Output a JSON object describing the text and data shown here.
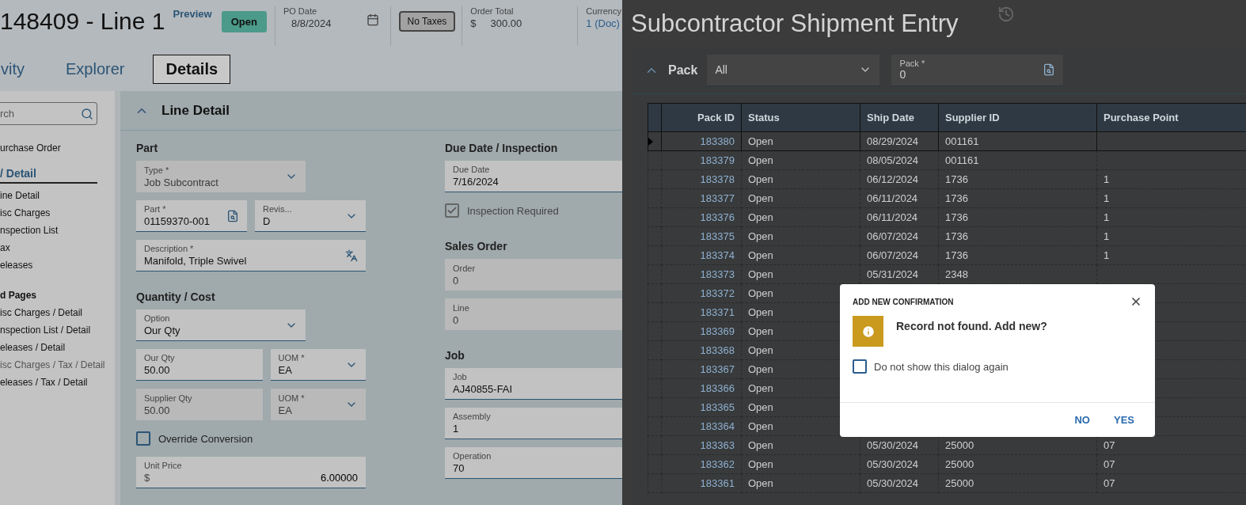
{
  "left_window": {
    "title": "148409 - Line 1",
    "preview_label": "Preview",
    "status_badge": "Open",
    "po_date": {
      "label": "PO Date",
      "value": "8/8/2024"
    },
    "tax_button": "No Taxes",
    "order_total": {
      "label": "Order Total",
      "currency_symbol": "$",
      "value": "300.00"
    },
    "currency": {
      "label": "Currency",
      "value": "1 (Doc)"
    },
    "tabs": [
      {
        "label": "vity",
        "selected": false
      },
      {
        "label": "Explorer",
        "selected": false
      },
      {
        "label": "Details",
        "selected": true
      }
    ],
    "sidebar": {
      "search": {
        "placeholder": "rch"
      },
      "items": [
        {
          "label": "urchase Order",
          "kind": "link",
          "disabled": false
        },
        {
          "label": "/ Detail",
          "kind": "current",
          "disabled": false
        },
        {
          "label": "ine Detail",
          "kind": "link",
          "disabled": false
        },
        {
          "label": "isc Charges",
          "kind": "link",
          "disabled": false
        },
        {
          "label": "nspection List",
          "kind": "link",
          "disabled": false
        },
        {
          "label": "ax",
          "kind": "link",
          "disabled": false
        },
        {
          "label": "eleases",
          "kind": "link",
          "disabled": false
        },
        {
          "label": "d Pages",
          "kind": "heading",
          "disabled": false
        },
        {
          "label": "isc Charges / Detail",
          "kind": "link",
          "disabled": false
        },
        {
          "label": "nspection List / Detail",
          "kind": "link",
          "disabled": false
        },
        {
          "label": "eleases / Detail",
          "kind": "link",
          "disabled": false
        },
        {
          "label": "isc Charges / Tax / Detail",
          "kind": "link",
          "disabled": true
        },
        {
          "label": "eleases / Tax / Detail",
          "kind": "link",
          "disabled": false
        }
      ]
    },
    "panel": {
      "title": "Line Detail",
      "expanded": true,
      "columns": [
        [
          {
            "title": "Part",
            "rows": [
              {
                "kind": "fields",
                "fields": [
                  {
                    "label": "Type *",
                    "value": "Job Subcontract",
                    "kind": "select",
                    "disabled": true
                  }
                ]
              },
              {
                "kind": "fields",
                "fields": [
                  {
                    "label": "Part *",
                    "value": "01159370-001",
                    "kind": "lookup",
                    "disabled": false
                  },
                  {
                    "label": "Revis...",
                    "value": "D",
                    "kind": "select",
                    "disabled": false
                  }
                ]
              },
              {
                "kind": "fields",
                "fields": [
                  {
                    "label": "Description *",
                    "value": "Manifold, Triple Swivel",
                    "kind": "translate",
                    "disabled": false
                  }
                ]
              }
            ]
          },
          {
            "title": "Quantity / Cost",
            "rows": [
              {
                "kind": "fields",
                "fields": [
                  {
                    "label": "Option",
                    "value": "Our Qty",
                    "kind": "select",
                    "disabled": false
                  }
                ]
              },
              {
                "kind": "fields",
                "fields": [
                  {
                    "label": "Our Qty",
                    "value": "50.00",
                    "kind": "text",
                    "disabled": false
                  },
                  {
                    "label": "UOM *",
                    "value": "EA",
                    "kind": "select",
                    "disabled": false
                  }
                ]
              },
              {
                "kind": "fields",
                "fields": [
                  {
                    "label": "Supplier Qty",
                    "value": "50.00",
                    "kind": "text",
                    "disabled": true
                  },
                  {
                    "label": "UOM *",
                    "value": "EA",
                    "kind": "select",
                    "disabled": true
                  }
                ]
              },
              {
                "kind": "checkbox",
                "label": "Override Conversion",
                "checked": false,
                "disabled": false
              },
              {
                "kind": "fields",
                "fields": [
                  {
                    "label": "Unit Price",
                    "prefix": "$",
                    "value": "6.00000",
                    "kind": "money",
                    "disabled": false
                  }
                ]
              }
            ]
          }
        ],
        [
          {
            "title": "Due Date / Inspection",
            "rows": [
              {
                "kind": "fields",
                "fields": [
                  {
                    "label": "Due Date",
                    "value": "7/16/2024",
                    "kind": "text",
                    "disabled": false
                  }
                ]
              },
              {
                "kind": "checkbox",
                "label": "Inspection Required",
                "checked": true,
                "disabled": true
              }
            ]
          },
          {
            "title": "Sales Order",
            "rows": [
              {
                "kind": "fields",
                "fields": [
                  {
                    "label": "Order",
                    "value": "0",
                    "kind": "text",
                    "disabled": true
                  }
                ]
              },
              {
                "kind": "fields",
                "fields": [
                  {
                    "label": "Line",
                    "value": "0",
                    "kind": "text",
                    "disabled": true
                  }
                ]
              }
            ]
          },
          {
            "title": "Job",
            "rows": [
              {
                "kind": "fields",
                "fields": [
                  {
                    "label": "Job",
                    "value": "AJ40855-FAI",
                    "kind": "text",
                    "disabled": false
                  }
                ]
              },
              {
                "kind": "fields",
                "fields": [
                  {
                    "label": "Assembly",
                    "value": "1",
                    "kind": "text",
                    "disabled": false
                  }
                ]
              },
              {
                "kind": "fields",
                "fields": [
                  {
                    "label": "Operation",
                    "value": "70",
                    "kind": "text",
                    "disabled": false
                  }
                ]
              }
            ]
          }
        ]
      ]
    }
  },
  "right_window": {
    "title": "Subcontractor Shipment Entry",
    "pack_bar": {
      "expanded": true,
      "label": "Pack",
      "filter": {
        "value": "All"
      },
      "pack_field": {
        "label": "Pack *",
        "value": "0"
      }
    },
    "table": {
      "columns": [
        "Pack ID",
        "Status",
        "Ship Date",
        "Supplier ID",
        "Purchase Point"
      ],
      "rows": [
        {
          "selected": true,
          "cells": [
            "183380",
            "Open",
            "08/29/2024",
            "001161"
          ]
        },
        {
          "selected": false,
          "cells": [
            "183379",
            "Open",
            "08/05/2024",
            "001161"
          ]
        },
        {
          "selected": false,
          "cells": [
            "183378",
            "Open",
            "06/12/2024",
            "1736",
            "1"
          ]
        },
        {
          "selected": false,
          "cells": [
            "183377",
            "Open",
            "06/11/2024",
            "1736",
            "1"
          ]
        },
        {
          "selected": false,
          "cells": [
            "183376",
            "Open",
            "06/11/2024",
            "1736",
            "1"
          ]
        },
        {
          "selected": false,
          "cells": [
            "183375",
            "Open",
            "06/07/2024",
            "1736",
            "1"
          ]
        },
        {
          "selected": false,
          "cells": [
            "183374",
            "Open",
            "06/07/2024",
            "1736",
            "1"
          ]
        },
        {
          "selected": false,
          "cells": [
            "183373",
            "Open",
            "05/31/2024",
            "2348"
          ]
        },
        {
          "selected": false,
          "cells": [
            "183372",
            "Open"
          ]
        },
        {
          "selected": false,
          "cells": [
            "183371",
            "Open"
          ]
        },
        {
          "selected": false,
          "cells": [
            "183369",
            "Open"
          ]
        },
        {
          "selected": false,
          "cells": [
            "183368",
            "Open"
          ]
        },
        {
          "selected": false,
          "cells": [
            "183367",
            "Open"
          ]
        },
        {
          "selected": false,
          "cells": [
            "183366",
            "Open"
          ]
        },
        {
          "selected": false,
          "cells": [
            "183365",
            "Open"
          ]
        },
        {
          "selected": false,
          "cells": [
            "183364",
            "Open"
          ]
        },
        {
          "selected": false,
          "cells": [
            "183363",
            "Open",
            "05/30/2024",
            "25000",
            "07"
          ]
        },
        {
          "selected": false,
          "cells": [
            "183362",
            "Open",
            "05/30/2024",
            "25000",
            "07"
          ]
        },
        {
          "selected": false,
          "cells": [
            "183361",
            "Open",
            "05/30/2024",
            "25000",
            "07"
          ]
        }
      ]
    },
    "dialog": {
      "title": "ADD NEW CONFIRMATION",
      "message": "Record not found. Add new?",
      "checkbox": {
        "label": "Do not show this dialog again",
        "checked": false
      },
      "buttons": [
        "NO",
        "YES"
      ]
    }
  }
}
